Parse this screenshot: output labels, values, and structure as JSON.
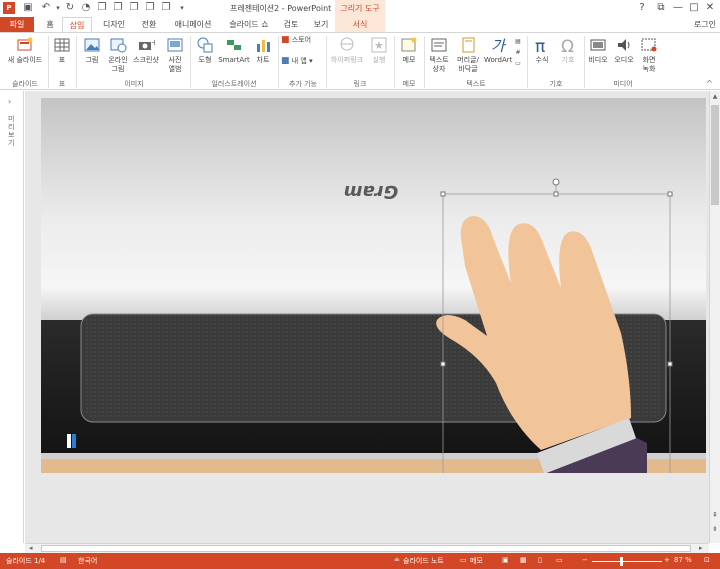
{
  "window": {
    "title": "프레젠테이션2 - PowerPoint",
    "context_tab_group": "그리기 도구",
    "controls": {
      "help": "?",
      "minimize": "—",
      "maximize": "□",
      "close": "✕"
    }
  },
  "tabs": {
    "file": "파일",
    "home": "홈",
    "insert": "삽입",
    "design": "디자인",
    "transitions": "전환",
    "animations": "애니메이션",
    "slideshow": "슬라이드 쇼",
    "review": "검토",
    "view": "보기",
    "format": "서식",
    "login": "로그인"
  },
  "ribbon": {
    "new_slide": "새 슬라이드",
    "table": "표",
    "picture": "그림",
    "online_picture_1": "온라인",
    "online_picture_2": "그림",
    "screenshot": "스크린샷",
    "photo_album_1": "사진",
    "photo_album_2": "앨범",
    "shapes": "도형",
    "smartart": "SmartArt",
    "chart": "차트",
    "store": "스토어",
    "my_apps": "내 앱",
    "hyperlink": "하이퍼링크",
    "action": "실행",
    "comment": "메모",
    "textbox_1": "텍스트",
    "textbox_2": "상자",
    "header_footer_1": "머리글/",
    "header_footer_2": "바닥글",
    "wordart": "WordArt",
    "equation": "수식",
    "symbol": "기호",
    "video": "비디오",
    "audio": "오디오",
    "screen_recording_1": "화면",
    "screen_recording_2": "녹화",
    "groups": {
      "slides": "슬라이드",
      "tables": "표",
      "images": "이미지",
      "illustrations": "일러스트레이션",
      "addins": "추가 기능",
      "links": "링크",
      "comments": "메모",
      "text": "텍스트",
      "symbols": "기호",
      "media": "미디어"
    }
  },
  "outline_label": "미리보기",
  "slide": {
    "brand_text": "Gram",
    "colors": {
      "skin": "#f2c49a",
      "sleeve": "#4b3a55",
      "cuff": "#d9d9d9",
      "desk": "#e3b98e"
    }
  },
  "status": {
    "slide_info": "슬라이드 1/4",
    "language": "한국어",
    "notes": "슬라이드 노트",
    "comments": "메모",
    "zoom": "87 %"
  }
}
